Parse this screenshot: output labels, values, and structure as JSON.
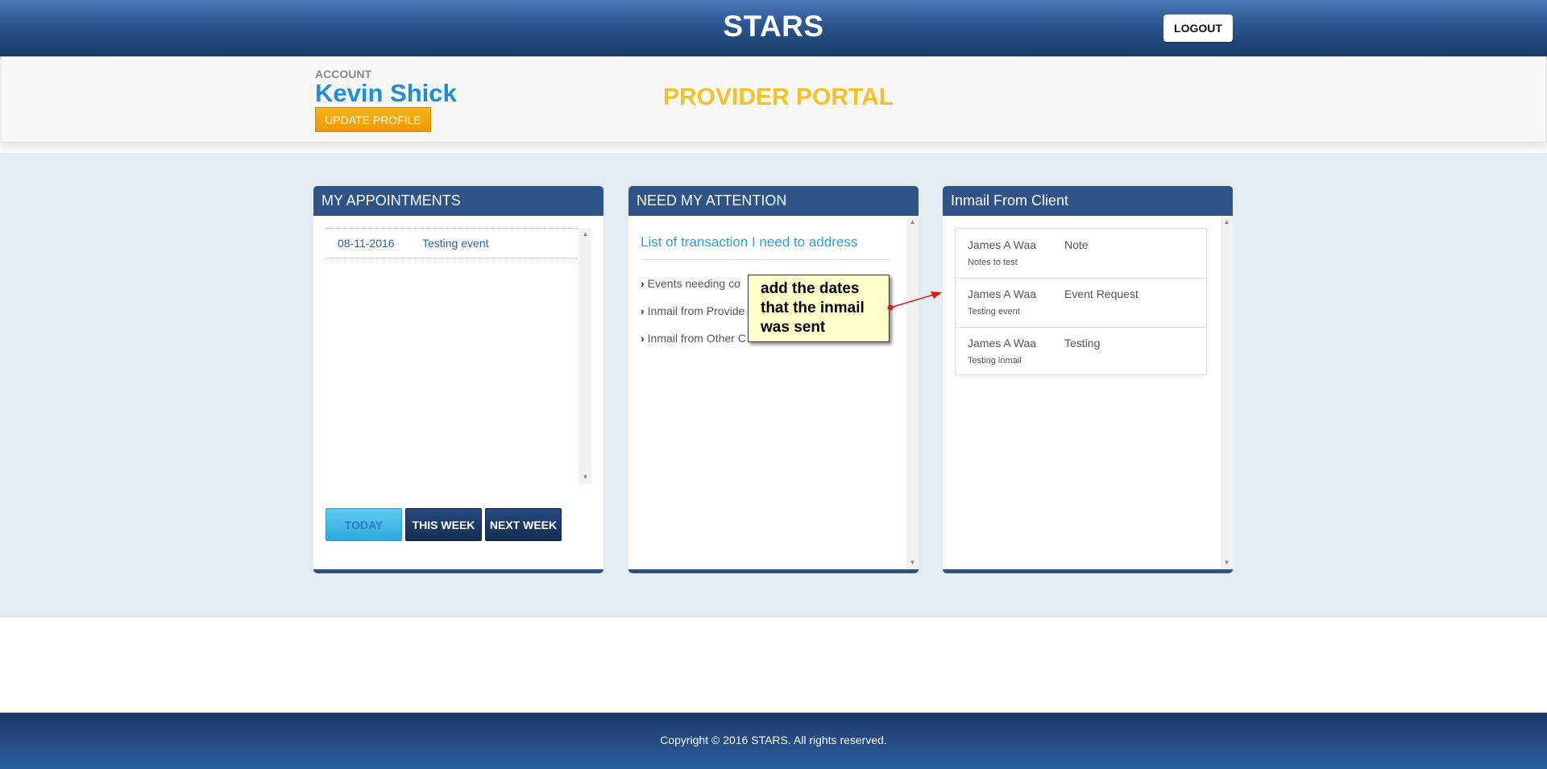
{
  "header": {
    "app_title": "STARS",
    "logout_label": "LOGOUT"
  },
  "account": {
    "label": "ACCOUNT",
    "name": "Kevin Shick",
    "update_label": "UPDATE PROFILE",
    "portal_title": "PROVIDER PORTAL"
  },
  "appointments": {
    "title": "MY APPOINTMENTS",
    "rows": [
      {
        "date": "08-11-2016",
        "title": "Testing event"
      }
    ],
    "buttons": {
      "today": "TODAY",
      "this_week": "THIS WEEK",
      "next_week": "NEXT WEEK"
    }
  },
  "attention": {
    "title": "NEED MY ATTENTION",
    "heading": "List of transaction I need to address",
    "items": [
      "Events needing co",
      "Inmail from Provide",
      "Inmail from Other C"
    ]
  },
  "inmail": {
    "title": "Inmail From Client",
    "rows": [
      {
        "from": "James A Waa",
        "subject": "Note",
        "preview": "Notes to test"
      },
      {
        "from": "James A Waa",
        "subject": "Event Request",
        "preview": "Testing event"
      },
      {
        "from": "James A Waa",
        "subject": "Testing",
        "preview": "Testing inmail"
      }
    ]
  },
  "annotation": {
    "lines": [
      "add the dates",
      "that the inmail",
      "was sent"
    ],
    "arrow_color": "#e01818"
  },
  "footer": {
    "copyright": "Copyright © 2016 STARS. All rights reserved."
  },
  "colors": {
    "header": "#2a558f",
    "accent_blue": "#1f8fd8",
    "portal_yellow": "#f5c124",
    "panel_head": "#2e5387"
  }
}
